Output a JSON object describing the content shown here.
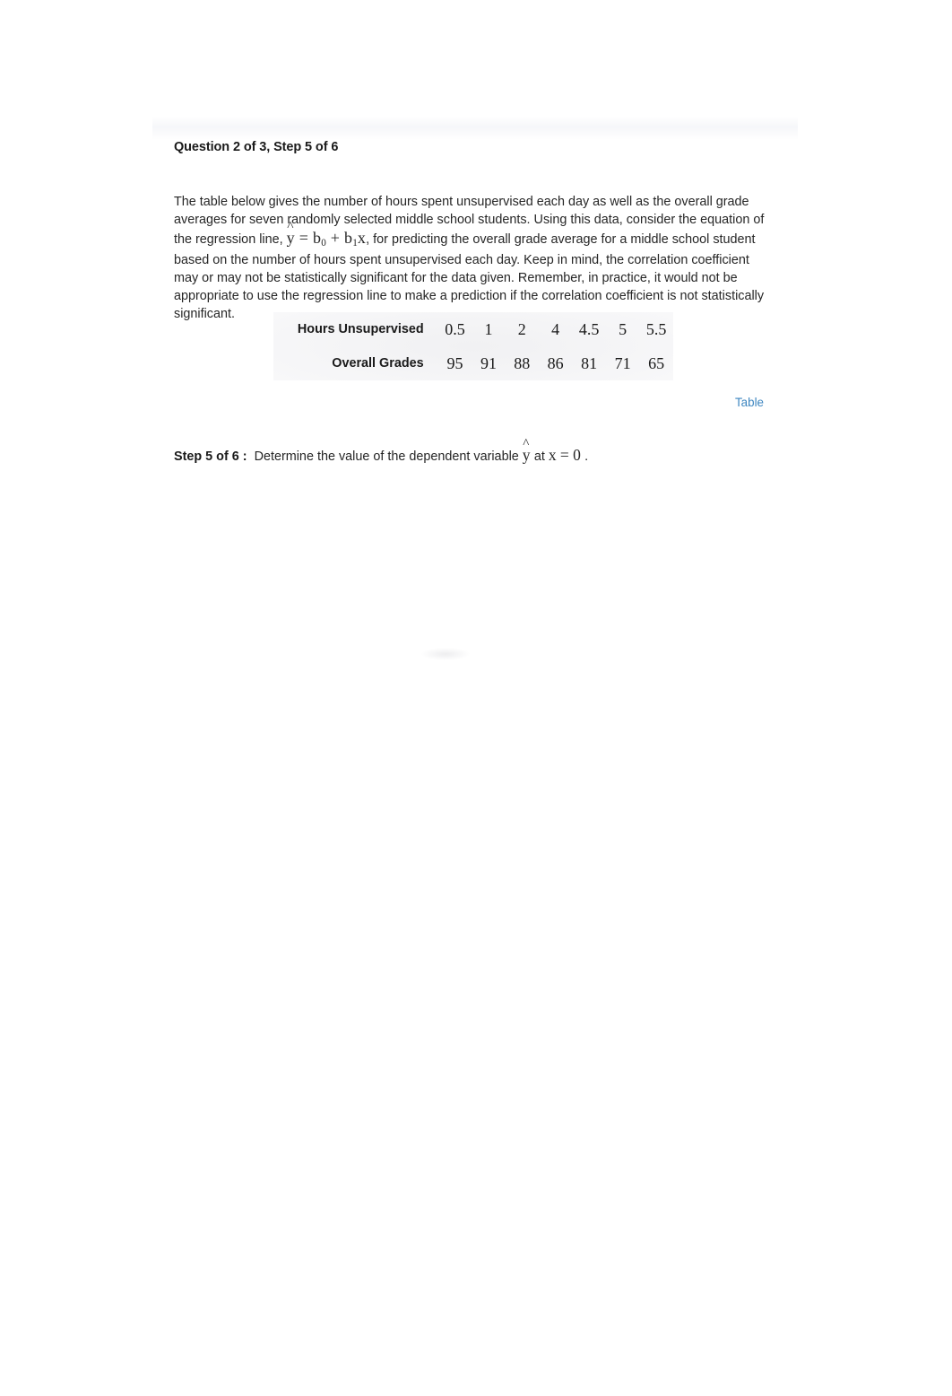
{
  "header": {
    "question_heading": "Question 2 of 3, Step 5 of 6"
  },
  "prompt": {
    "part1": "The table below gives the number of hours spent unsupervised each day as well as the overall grade averages for seven randomly selected middle school students. Using this data, consider the equation of the regression line, ",
    "formula": {
      "lhs": "y",
      "equals": "=",
      "b0": "b",
      "b0_sub": "0",
      "plus": "+",
      "b1": "b",
      "b1_sub": "1",
      "x": "x"
    },
    "part2": ", for predicting the overall grade average for a middle school student based on the number of hours spent unsupervised each day. Keep in mind, the correlation coefficient may or may not be statistically significant for the data given. Remember, in practice, it would not be appropriate to use the regression line to make a prediction if the correlation coefficient is not statistically significant."
  },
  "chart_data": {
    "type": "table",
    "title": "",
    "rows": [
      {
        "label": "Hours Unsupervised",
        "values": [
          "0.5",
          "1",
          "2",
          "4",
          "4.5",
          "5",
          "5.5"
        ]
      },
      {
        "label": "Overall Grades",
        "values": [
          "95",
          "91",
          "88",
          "86",
          "81",
          "71",
          "65"
        ]
      }
    ],
    "xlabel": "Hours Unsupervised",
    "ylabel": "Overall Grades",
    "x": [
      0.5,
      1,
      2,
      4,
      4.5,
      5,
      5.5
    ],
    "values": [
      95,
      91,
      88,
      86,
      81,
      71,
      65
    ]
  },
  "links": {
    "table_label": "Table"
  },
  "step": {
    "label": "Step 5 of 6 :",
    "text_before": "Determine the value of the dependent variable",
    "yhat": "y",
    "at": "at",
    "x_var": "x",
    "equals": "=",
    "x_value": "0",
    "period": "."
  },
  "colors": {
    "link_blue": "#3d86c0",
    "text": "#262626",
    "heading": "#1a1a1a",
    "page_background": "#ffffff",
    "table_shade": "#f0f0f2"
  }
}
